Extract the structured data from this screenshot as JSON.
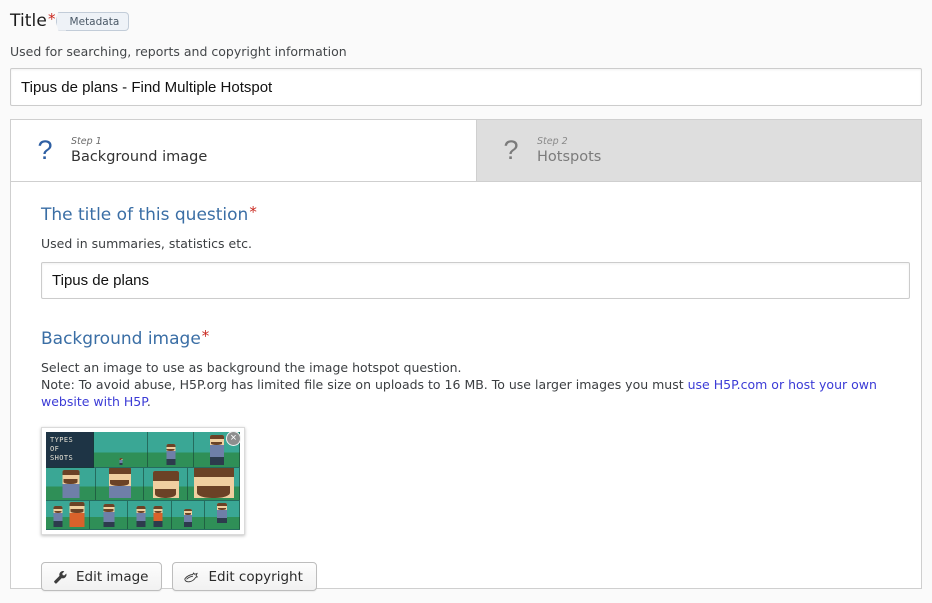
{
  "metadata_form": {
    "title_label": "Title",
    "required_mark": "*",
    "metadata_badge": "Metadata",
    "description": "Used for searching, reports and copyright information",
    "title_value": "Tipus de plans - Find Multiple Hotspot",
    "title_placeholder": "Title"
  },
  "wizard": {
    "tabs": [
      {
        "icon": "question-mark-icon",
        "icon_glyph": "?",
        "step": "Step 1",
        "name": "Background image",
        "active": true
      },
      {
        "icon": "question-mark-icon",
        "icon_glyph": "?",
        "step": "Step 2",
        "name": "Hotspots",
        "active": false
      }
    ]
  },
  "question_title": {
    "label": "The title of this question",
    "required_mark": "*",
    "description": "Used in summaries, statistics etc.",
    "value": "Tipus de plans",
    "placeholder": "The title of this question"
  },
  "background_image": {
    "label": "Background image",
    "required_mark": "*",
    "description_line1": "Select an image to use as background the image hotspot question.",
    "description_line2_prefix": "Note: To avoid abuse, H5P.org has limited file size on uploads to 16 MB. To use larger images you must ",
    "link_text": "use H5P.com or host your own website with H5P",
    "description_line2_suffix": ".",
    "remove_button": "×",
    "thumbnail": {
      "alt": "Types of shots infographic thumbnail",
      "caption": [
        "TYPES",
        "OF",
        "SHOTS"
      ]
    }
  },
  "actions": {
    "edit_image": {
      "label": "Edit image",
      "icon": "wrench-icon"
    },
    "edit_copyright": {
      "label": "Edit copyright",
      "icon": "copyright-icon"
    }
  },
  "colors": {
    "accent_blue": "#3a6ea5",
    "tab_active_icon": "#2e5fa3",
    "required_red": "#c9271e",
    "link_blue": "#3b3bd6",
    "tab_inactive_bg": "#dedede",
    "page_bg": "#fafafa"
  }
}
